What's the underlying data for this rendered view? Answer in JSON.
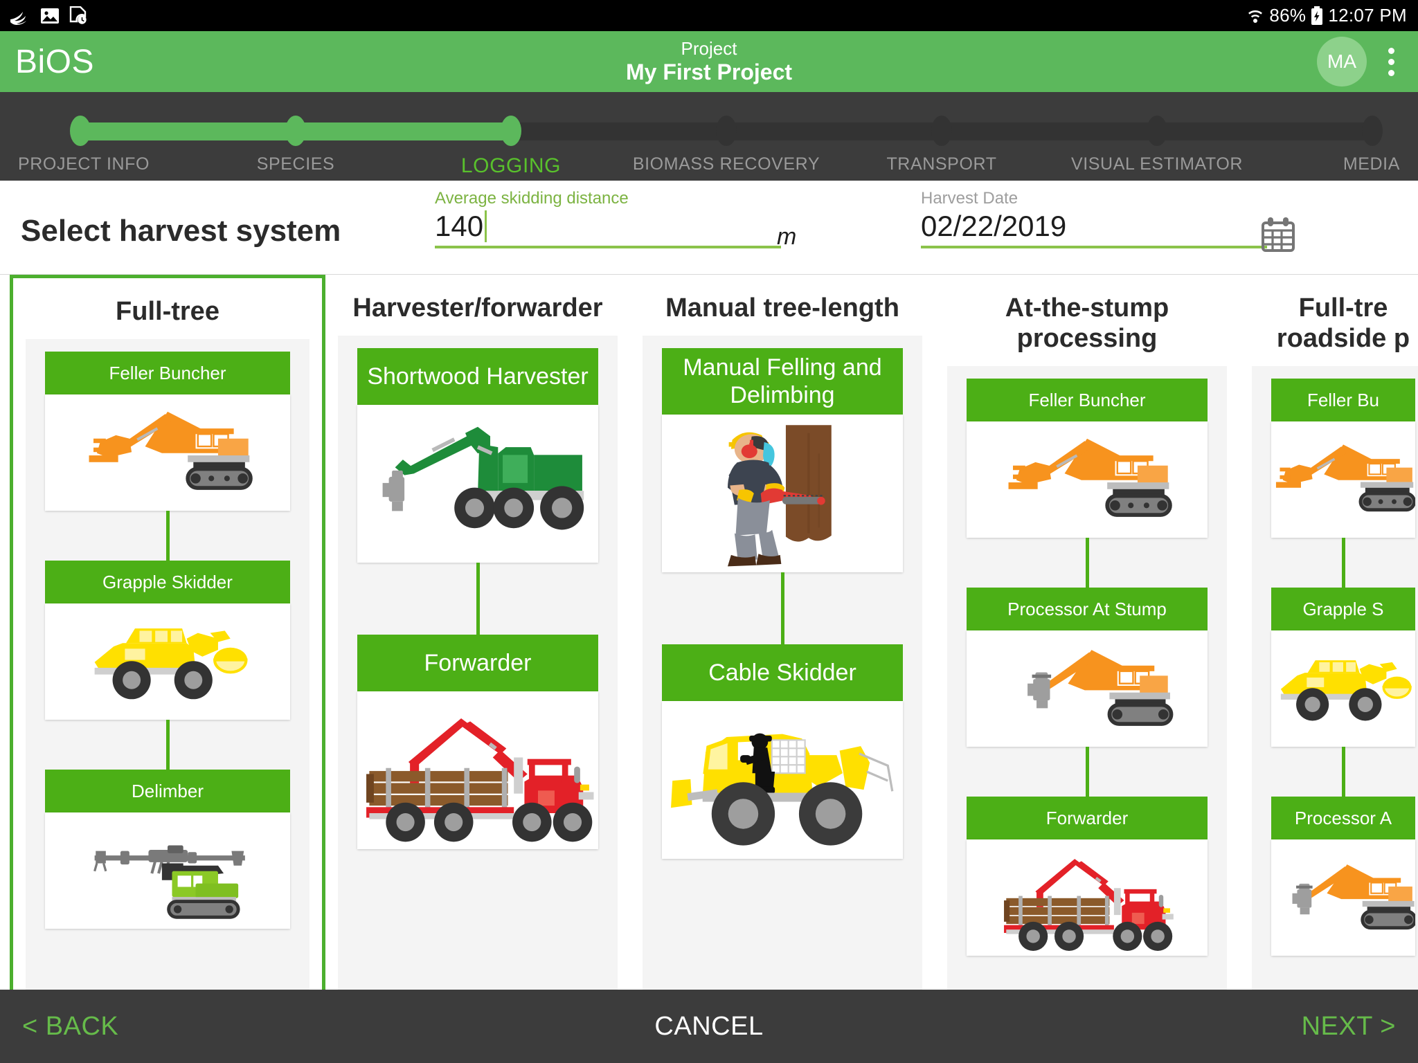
{
  "statusbar": {
    "icons": [
      "swiftkey-swoosh-icon",
      "image-icon",
      "document-clock-icon"
    ],
    "battery_percent": "86%",
    "battery_state": "charging",
    "time": "12:07 PM"
  },
  "appbar": {
    "brand": "BiOS",
    "title_sub": "Project",
    "title_main": "My First Project",
    "avatar_initials": "MA",
    "overflow_icon": "kebab-menu-icon",
    "bg_color": "#5cb85c"
  },
  "stepper": {
    "active_index": 2,
    "steps": [
      {
        "label": "PROJECT INFO",
        "state": "done"
      },
      {
        "label": "SPECIES",
        "state": "done"
      },
      {
        "label": "LOGGING",
        "state": "active"
      },
      {
        "label": "BIOMASS RECOVERY",
        "state": "todo"
      },
      {
        "label": "TRANSPORT",
        "state": "todo"
      },
      {
        "label": "VISUAL ESTIMATOR",
        "state": "todo"
      },
      {
        "label": "MEDIA",
        "state": "todo"
      }
    ],
    "active_color": "#59c12c",
    "inactive_color": "#9a9a9a",
    "bg_color": "#3c3c3c"
  },
  "form": {
    "page_title": "Select harvest system",
    "skidding": {
      "label": "Average skidding distance",
      "value": "140",
      "unit": "m",
      "focused": true
    },
    "harvest_date": {
      "label": "Harvest Date",
      "value": "02/22/2019",
      "calendar_icon": "calendar-icon"
    }
  },
  "systems": [
    {
      "title": "Full-tree",
      "selected": true,
      "nodes": [
        {
          "label": "Feller Buncher",
          "image": "feller-buncher-orange-tracked"
        },
        {
          "label": "Grapple Skidder",
          "image": "grapple-skidder-yellow"
        },
        {
          "label": "Delimber",
          "image": "delimber-green-tracked"
        }
      ]
    },
    {
      "title": "Harvester/forwarder",
      "selected": false,
      "nodes": [
        {
          "label": "Shortwood Harvester",
          "image": "shortwood-harvester-green-wheeled"
        },
        {
          "label": "Forwarder",
          "image": "forwarder-red-loaded"
        }
      ]
    },
    {
      "title": "Manual tree-length",
      "selected": false,
      "nodes": [
        {
          "label": "Manual Felling and Delimbing",
          "image": "chainsaw-logger-tree"
        },
        {
          "label": "Cable Skidder",
          "image": "cable-skidder-yellow"
        }
      ]
    },
    {
      "title": "At-the-stump\nprocessing",
      "selected": false,
      "nodes": [
        {
          "label": "Feller Buncher",
          "image": "feller-buncher-orange-tracked"
        },
        {
          "label": "Processor At Stump",
          "image": "processor-orange-tracked"
        },
        {
          "label": "Forwarder",
          "image": "forwarder-red-loaded"
        }
      ]
    },
    {
      "title": "Full-tre\nroadside p",
      "selected": false,
      "clipped": true,
      "nodes": [
        {
          "label": "Feller Bu",
          "image": "feller-buncher-orange-tracked"
        },
        {
          "label": "Grapple S",
          "image": "grapple-skidder-yellow"
        },
        {
          "label": "Processor A",
          "image": "processor-orange-tracked"
        }
      ]
    }
  ],
  "bottombar": {
    "back": "< BACK",
    "cancel": "CANCEL",
    "next": "NEXT >",
    "accent": "#66bb4a",
    "bg_color": "#3c3c3c"
  }
}
